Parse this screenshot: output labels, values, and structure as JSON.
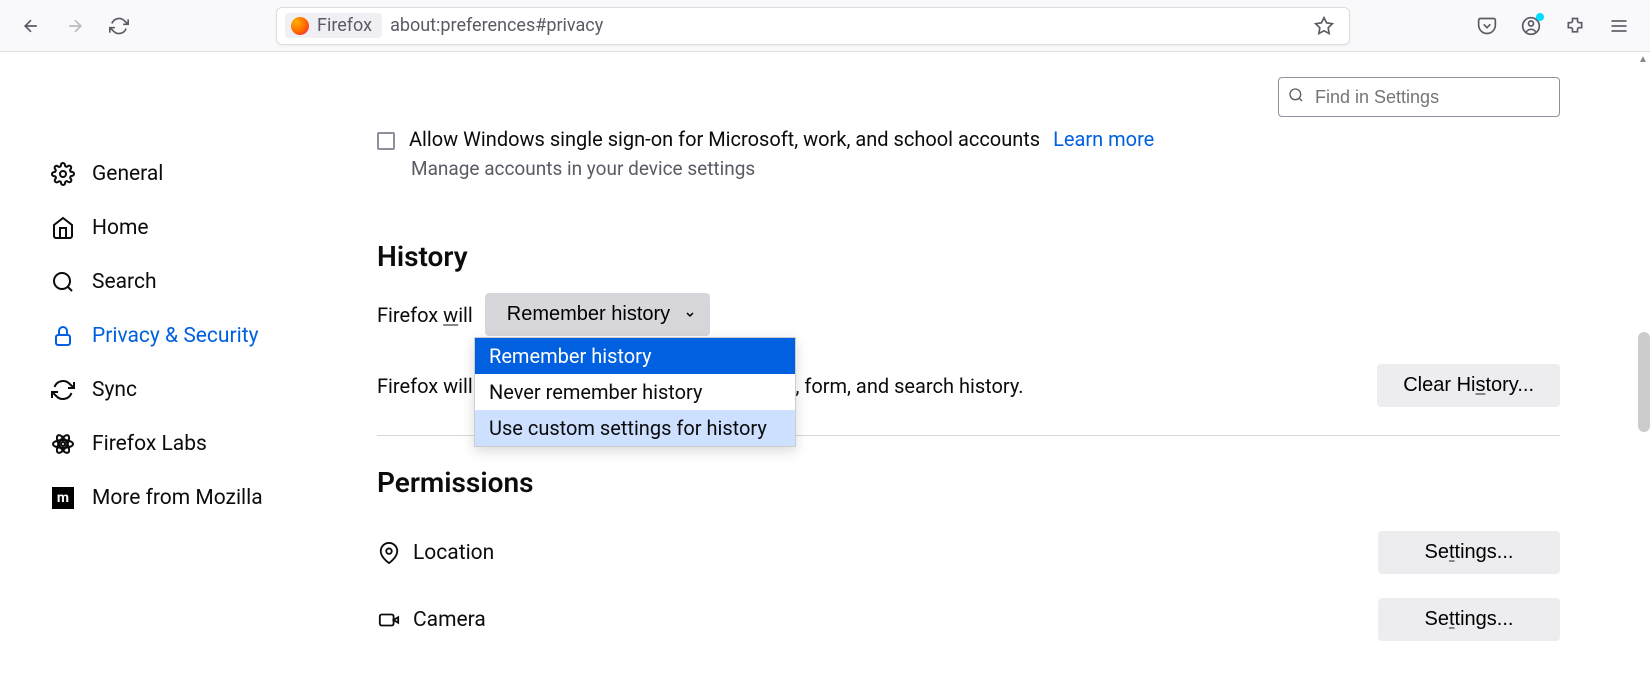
{
  "toolbar": {
    "identity_label": "Firefox",
    "url": "about:preferences#privacy"
  },
  "search": {
    "placeholder": "Find in Settings"
  },
  "sidebar": {
    "items": [
      {
        "label": "General"
      },
      {
        "label": "Home"
      },
      {
        "label": "Search"
      },
      {
        "label": "Privacy & Security"
      },
      {
        "label": "Sync"
      },
      {
        "label": "Firefox Labs"
      },
      {
        "label": "More from Mozilla"
      }
    ]
  },
  "logins": {
    "sso_label": "Allow Windows single sign-on for Microsoft, work, and school accounts",
    "learn_more": "Learn more",
    "sso_desc": "Manage accounts in your device settings"
  },
  "history": {
    "heading": "History",
    "will_prefix": "Firefox ",
    "will_underlined": "w",
    "will_suffix": "ill",
    "dropdown_selected": "Remember history",
    "dropdown_options": {
      "opt0": "Remember history",
      "opt1": "Never remember history",
      "opt2": "Use custom settings for history"
    },
    "desc": "Firefox will remember your browsing, download, form, and search history.",
    "clear_btn_prefix": "Clear Hi",
    "clear_btn_underlined": "s",
    "clear_btn_suffix": "tory..."
  },
  "permissions": {
    "heading": "Permissions",
    "rows": {
      "location": {
        "label": "Location",
        "btn_prefix": "Se",
        "btn_u": "t",
        "btn_suffix": "tings..."
      },
      "camera": {
        "label": "Camera",
        "btn_prefix": "Se",
        "btn_u": "t",
        "btn_suffix": "tings..."
      }
    }
  }
}
